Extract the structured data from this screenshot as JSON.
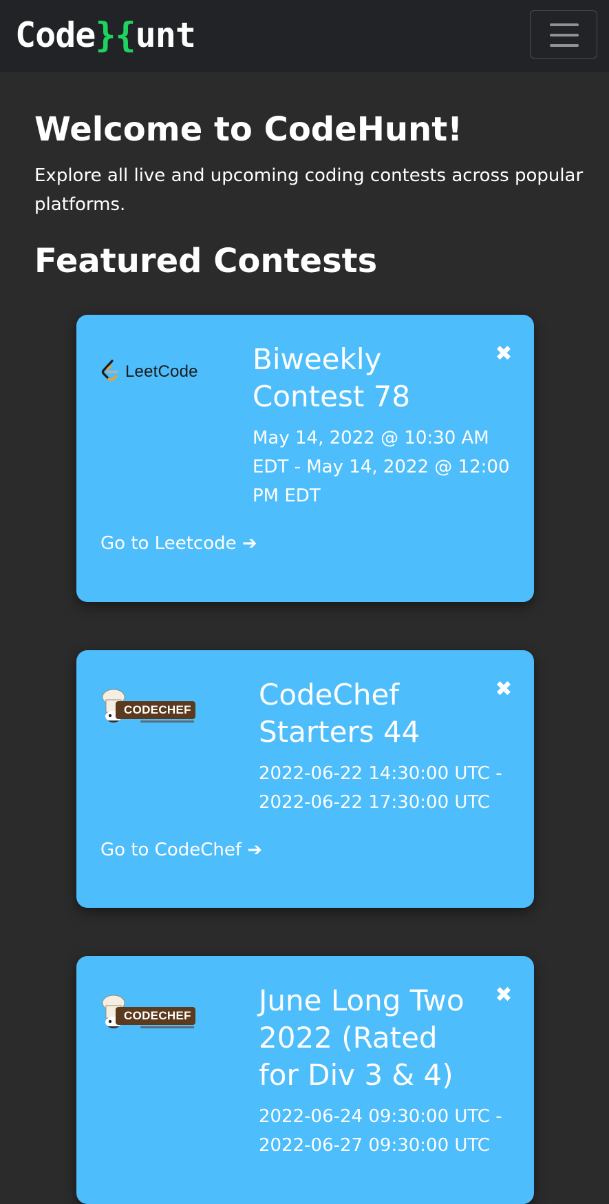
{
  "navbar": {
    "brand_left": "Code",
    "brand_brace_close": "}",
    "brand_brace_open": "{",
    "brand_right": "unt",
    "menu_icon": "hamburger-menu-icon"
  },
  "hero": {
    "title": "Welcome to CodeHunt!",
    "text": "Explore all live and upcoming coding contests across popular platforms."
  },
  "featured": {
    "title": "Featured Contests"
  },
  "contests": [
    {
      "logo_text": "LeetCode",
      "title": "Biweekly Contest 78",
      "time": "May 14, 2022 @ 10:30 AM EDT - May 14, 2022 @ 12:00 PM EDT",
      "link_label": "Go to Leetcode",
      "close_symbol": "✖",
      "arrow_symbol": "➔"
    },
    {
      "logo_text": "CODECHEF",
      "title": "CodeChef Starters 44",
      "time": "2022-06-22 14:30:00 UTC - 2022-06-22 17:30:00 UTC",
      "link_label": "Go to CodeChef",
      "close_symbol": "✖",
      "arrow_symbol": "➔"
    },
    {
      "logo_text": "CODECHEF",
      "title": "June Long Two 2022 (Rated for Div 3 & 4)",
      "time": "2022-06-24 09:30:00 UTC - 2022-06-27 09:30:00 UTC",
      "close_symbol": "✖"
    }
  ],
  "colors": {
    "background": "#2b2b2b",
    "navbar": "#212327",
    "brand_accent": "#1fd35f",
    "card": "#4dbdfb",
    "leetcode_orange": "#f89f1b",
    "codechef_brown": "#5b3a1e"
  }
}
